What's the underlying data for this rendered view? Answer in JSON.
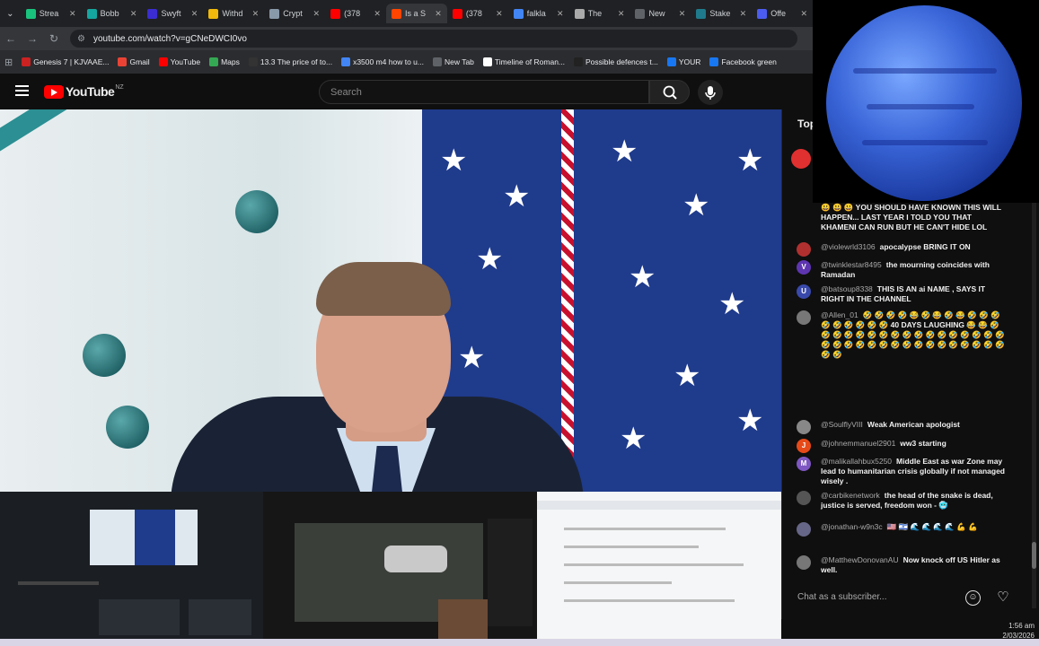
{
  "browser": {
    "tabs": [
      {
        "title": "Strea",
        "color": "#19c37d"
      },
      {
        "title": "Bobb",
        "color": "#15a6a0"
      },
      {
        "title": "Swyft",
        "color": "#3b2dd1"
      },
      {
        "title": "Withd",
        "color": "#f0b90b"
      },
      {
        "title": "Crypt",
        "color": "#8899aa"
      },
      {
        "title": "(378",
        "color": "#ff0000"
      },
      {
        "title": "Is a S",
        "color": "#ff4500"
      },
      {
        "title": "(378",
        "color": "#ff0000"
      },
      {
        "title": "falkla",
        "color": "#4285f4"
      },
      {
        "title": "The",
        "color": "#aaaaaa"
      },
      {
        "title": "New",
        "color": "#5f6368"
      },
      {
        "title": "Stake",
        "color": "#1f7a8c"
      },
      {
        "title": "Offe",
        "color": "#4b5cf0"
      }
    ],
    "url": "youtube.com/watch?v=gCNeDWCI0vo",
    "bookmarks": [
      {
        "label": "Genesis 7 | KJVAAE...",
        "color": "#cc2222"
      },
      {
        "label": "Gmail",
        "color": "#ea4335"
      },
      {
        "label": "YouTube",
        "color": "#ff0000"
      },
      {
        "label": "Maps",
        "color": "#34a853"
      },
      {
        "label": "13.3 The price of to...",
        "color": "#333333"
      },
      {
        "label": "x3500 m4 how to u...",
        "color": "#4285f4"
      },
      {
        "label": "New Tab",
        "color": "#5f6368"
      },
      {
        "label": "Timeline of Roman...",
        "color": "#ffffff"
      },
      {
        "label": "Possible defences t...",
        "color": "#222222"
      },
      {
        "label": "YOUR",
        "color": "#1877f2"
      },
      {
        "label": "Facebook green",
        "color": "#1877f2"
      }
    ]
  },
  "youtube": {
    "logo_text": "YouTube",
    "country_code": "NZ",
    "search_placeholder": "Search"
  },
  "chat": {
    "header": "Top",
    "messages": [
      {
        "author": "",
        "text": "😃 😃 😃 YOU SHOULD HAVE KNOWN THIS WILL HAPPEN... LAST YEAR I TOLD YOU THAT KHAMENI CAN RUN BUT HE CAN'T HIDE LOL",
        "avatar": "",
        "color": "#cc6a2a"
      },
      {
        "author": "@violewrld3106",
        "text": "apocalypse BRING IT ON",
        "avatar": "",
        "color": "#b03030"
      },
      {
        "author": "@twinklestar8495",
        "text": "the mourning coincides with Ramadan",
        "avatar": "V",
        "color": "#5e35b1"
      },
      {
        "author": "@batsoup8338",
        "text": "THIS IS AN ai NAME , SAYS IT RIGHT IN THE CHANNEL",
        "avatar": "U",
        "color": "#3949ab"
      },
      {
        "author": "@Allen_01",
        "text": "🤣 🤣 🤣 🤣 😂 🤣 😂 🤣 😂 🤣 🤣 🤣 🤣 🤣 🤣 🤣 🤣 🤣 40 DAYS LAUGHING 😂 😂 🤣 🤣 🤣 🤣 🤣 🤣 🤣 🤣 🤣 🤣 🤣 🤣 🤣 🤣 🤣 🤣 🤣 🤣 🤣 🤣 🤣 🤣 🤣 🤣 🤣 🤣 🤣 🤣 🤣 🤣 🤣 🤣 🤣 🤣 🤣",
        "avatar": "",
        "color": "#777777"
      },
      {
        "author": "@SoulflyVIII",
        "text": "Weak American apologist",
        "avatar": "",
        "color": "#888888"
      },
      {
        "author": "@johnemmanuel2901",
        "text": "ww3 starting",
        "avatar": "J",
        "color": "#e64a19"
      },
      {
        "author": "@malikallahbux5250",
        "text": "Middle East as war Zone may lead to humanitarian crisis globally if not managed wisely .",
        "avatar": "M",
        "color": "#7e57c2"
      },
      {
        "author": "@carbikenetwork",
        "text": "the head of the snake is dead, justice is served, freedom won - 🥶",
        "avatar": "",
        "color": "#555555"
      },
      {
        "author": "@jonathan-w9n3c",
        "text": "🇺🇸 🇮🇱 🌊 🌊 🌊 🌊 💪 💪",
        "avatar": "",
        "color": "#666688"
      },
      {
        "author": "@MatthewDonovanAU",
        "text": "Now knock off US Hitler as well.",
        "avatar": "",
        "color": "#777777"
      }
    ],
    "input_placeholder": "Chat as a subscriber..."
  },
  "system": {
    "time": "1:56 am",
    "date": "2/03/2026"
  },
  "icons": {
    "menu": "hamburger-icon",
    "search": "search-icon",
    "mic": "microphone-icon",
    "emoji": "emoji-icon",
    "heart": "heart-icon"
  }
}
